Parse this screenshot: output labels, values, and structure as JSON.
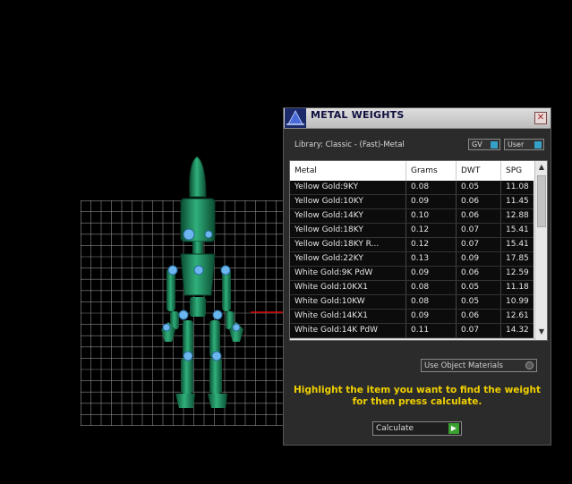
{
  "panel": {
    "title": "METAL WEIGHTS",
    "close_label": "✕",
    "library_label": "Library: Classic - (Fast)-Metal",
    "gv_label": "GV",
    "user_label": "User",
    "columns": [
      "Metal",
      "Grams",
      "DWT",
      "SPG"
    ],
    "rows": [
      [
        "Yellow Gold:9KY",
        "0.08",
        "0.05",
        "11.08"
      ],
      [
        "Yellow Gold:10KY",
        "0.09",
        "0.06",
        "11.45"
      ],
      [
        "Yellow Gold:14KY",
        "0.10",
        "0.06",
        "12.88"
      ],
      [
        "Yellow Gold:18KY",
        "0.12",
        "0.07",
        "15.41"
      ],
      [
        "Yellow Gold:18KY R...",
        "0.12",
        "0.07",
        "15.41"
      ],
      [
        "Yellow Gold:22KY",
        "0.13",
        "0.09",
        "17.85"
      ],
      [
        "White Gold:9K PdW",
        "0.09",
        "0.06",
        "12.59"
      ],
      [
        "White Gold:10KX1",
        "0.08",
        "0.05",
        "11.18"
      ],
      [
        "White Gold:10KW",
        "0.08",
        "0.05",
        "10.99"
      ],
      [
        "White Gold:14KX1",
        "0.09",
        "0.06",
        "12.61"
      ],
      [
        "White Gold:14K PdW",
        "0.11",
        "0.07",
        "14.32"
      ]
    ],
    "use_object_materials": "Use Object Materials",
    "instructions": "Highlight the item you want to find the weight for then press calculate.",
    "calculate_label": "Calculate"
  },
  "colors": {
    "instruction_text": "#f0d000",
    "robot_body": "#1d8a5e",
    "joint": "#6cb6f0",
    "toggle_on": "#35a0c8",
    "go_button": "#3aa030"
  }
}
